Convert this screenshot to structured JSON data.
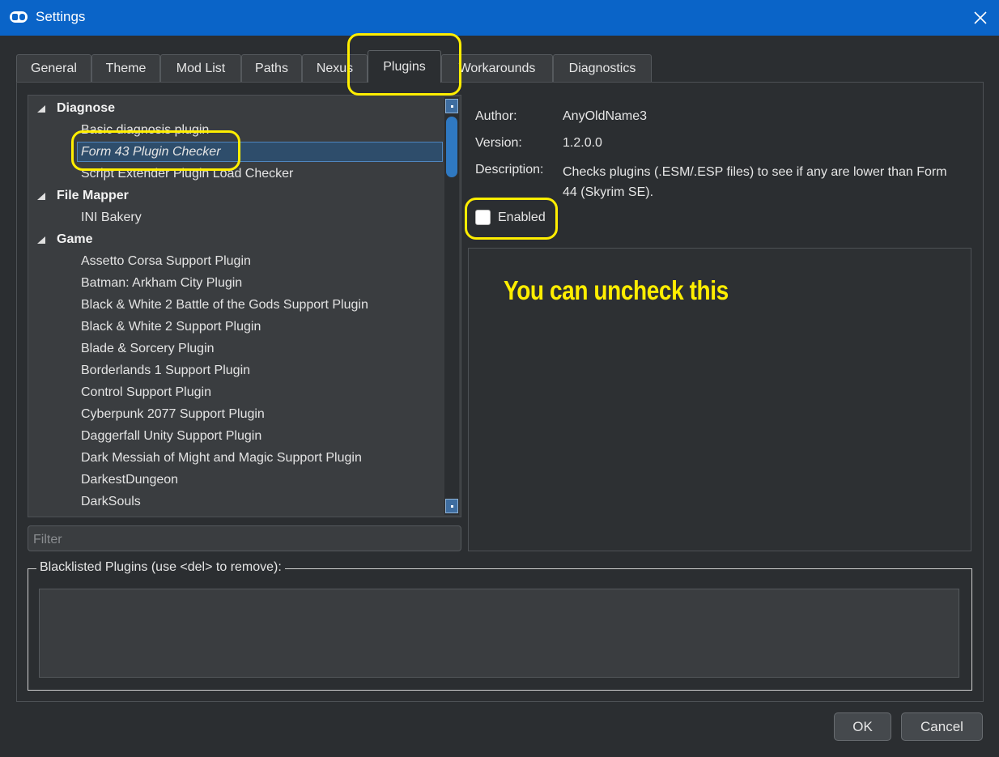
{
  "window": {
    "title": "Settings",
    "close_label": "✕"
  },
  "tabs": [
    {
      "label": "General"
    },
    {
      "label": "Theme"
    },
    {
      "label": "Mod List"
    },
    {
      "label": "Paths"
    },
    {
      "label": "Nexus"
    },
    {
      "label": "Plugins"
    },
    {
      "label": "Workarounds"
    },
    {
      "label": "Diagnostics"
    }
  ],
  "active_tab": "Plugins",
  "plugin_tree": {
    "rows": [
      {
        "type": "group",
        "label": "Diagnose"
      },
      {
        "type": "leaf",
        "label": "Basic diagnosis plugin"
      },
      {
        "type": "leaf",
        "label": "Form 43 Plugin Checker",
        "selected": true
      },
      {
        "type": "leaf",
        "label": "Script Extender Plugin Load Checker"
      },
      {
        "type": "group",
        "label": "File Mapper"
      },
      {
        "type": "leaf",
        "label": "INI Bakery"
      },
      {
        "type": "group",
        "label": "Game"
      },
      {
        "type": "leaf",
        "label": "Assetto Corsa Support Plugin"
      },
      {
        "type": "leaf",
        "label": "Batman: Arkham City Plugin"
      },
      {
        "type": "leaf",
        "label": "Black & White 2 Battle of the Gods Support Plugin"
      },
      {
        "type": "leaf",
        "label": "Black & White 2 Support Plugin"
      },
      {
        "type": "leaf",
        "label": "Blade & Sorcery Plugin"
      },
      {
        "type": "leaf",
        "label": "Borderlands 1 Support Plugin"
      },
      {
        "type": "leaf",
        "label": "Control Support Plugin"
      },
      {
        "type": "leaf",
        "label": "Cyberpunk 2077 Support Plugin"
      },
      {
        "type": "leaf",
        "label": "Daggerfall Unity Support Plugin"
      },
      {
        "type": "leaf",
        "label": "Dark Messiah of Might and Magic Support Plugin"
      },
      {
        "type": "leaf",
        "label": "DarkestDungeon"
      },
      {
        "type": "leaf",
        "label": "DarkSouls"
      }
    ]
  },
  "filter": {
    "placeholder": "Filter",
    "value": ""
  },
  "details": {
    "author_label": "Author:",
    "author_value": "AnyOldName3",
    "version_label": "Version:",
    "version_value": "1.2.0.0",
    "description_label": "Description:",
    "description_value": "Checks plugins (.ESM/.ESP files) to see if any are lower than Form 44 (Skyrim SE).",
    "enabled_label": "Enabled",
    "enabled_checked": false
  },
  "annotation": {
    "note": "You can uncheck this",
    "color": "#ffee00"
  },
  "blacklist": {
    "title": "Blacklisted Plugins (use <del> to remove):",
    "items": []
  },
  "buttons": {
    "ok": "OK",
    "cancel": "Cancel"
  },
  "colors": {
    "titlebar": "#0a64c8",
    "background": "#2b2e31",
    "selection": "#2e4d6b"
  }
}
